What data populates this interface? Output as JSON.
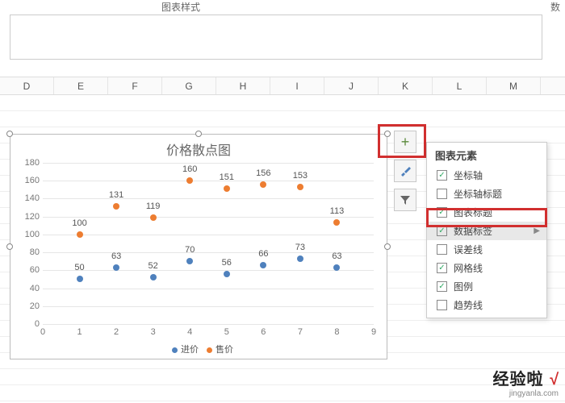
{
  "ribbon": {
    "group_label": "图表样式",
    "right_hint": "数"
  },
  "columns": [
    "D",
    "E",
    "F",
    "G",
    "H",
    "I",
    "J",
    "K",
    "L",
    "M"
  ],
  "chart_data": {
    "type": "scatter",
    "title": "价格散点图",
    "xlabel": "",
    "ylabel": "",
    "xlim": [
      0,
      9
    ],
    "ylim": [
      0,
      180
    ],
    "x_ticks": [
      0,
      1,
      2,
      3,
      4,
      5,
      6,
      7,
      8,
      9
    ],
    "y_ticks": [
      0,
      20,
      40,
      60,
      80,
      100,
      120,
      140,
      160,
      180
    ],
    "series": [
      {
        "name": "进价",
        "color": "#4f81bd",
        "values": [
          50,
          63,
          52,
          70,
          56,
          66,
          73,
          63
        ]
      },
      {
        "name": "售价",
        "color": "#ed7d31",
        "values": [
          100,
          131,
          119,
          160,
          151,
          156,
          153,
          113
        ]
      }
    ],
    "x": [
      1,
      2,
      3,
      4,
      5,
      6,
      7,
      8
    ],
    "legend_position": "bottom",
    "grid": true
  },
  "side_buttons": {
    "plus": "+",
    "brush_icon": "brush-icon",
    "filter_icon": "filter-icon"
  },
  "elements_panel": {
    "title": "图表元素",
    "items": [
      {
        "label": "坐标轴",
        "checked": true
      },
      {
        "label": "坐标轴标题",
        "checked": false
      },
      {
        "label": "图表标题",
        "checked": true
      },
      {
        "label": "数据标签",
        "checked": true,
        "hover": true,
        "submenu": true
      },
      {
        "label": "误差线",
        "checked": false
      },
      {
        "label": "网格线",
        "checked": true
      },
      {
        "label": "图例",
        "checked": true
      },
      {
        "label": "趋势线",
        "checked": false
      }
    ]
  },
  "watermark": {
    "main": "经验啦",
    "check": "√",
    "sub": "jingyanla.com"
  }
}
